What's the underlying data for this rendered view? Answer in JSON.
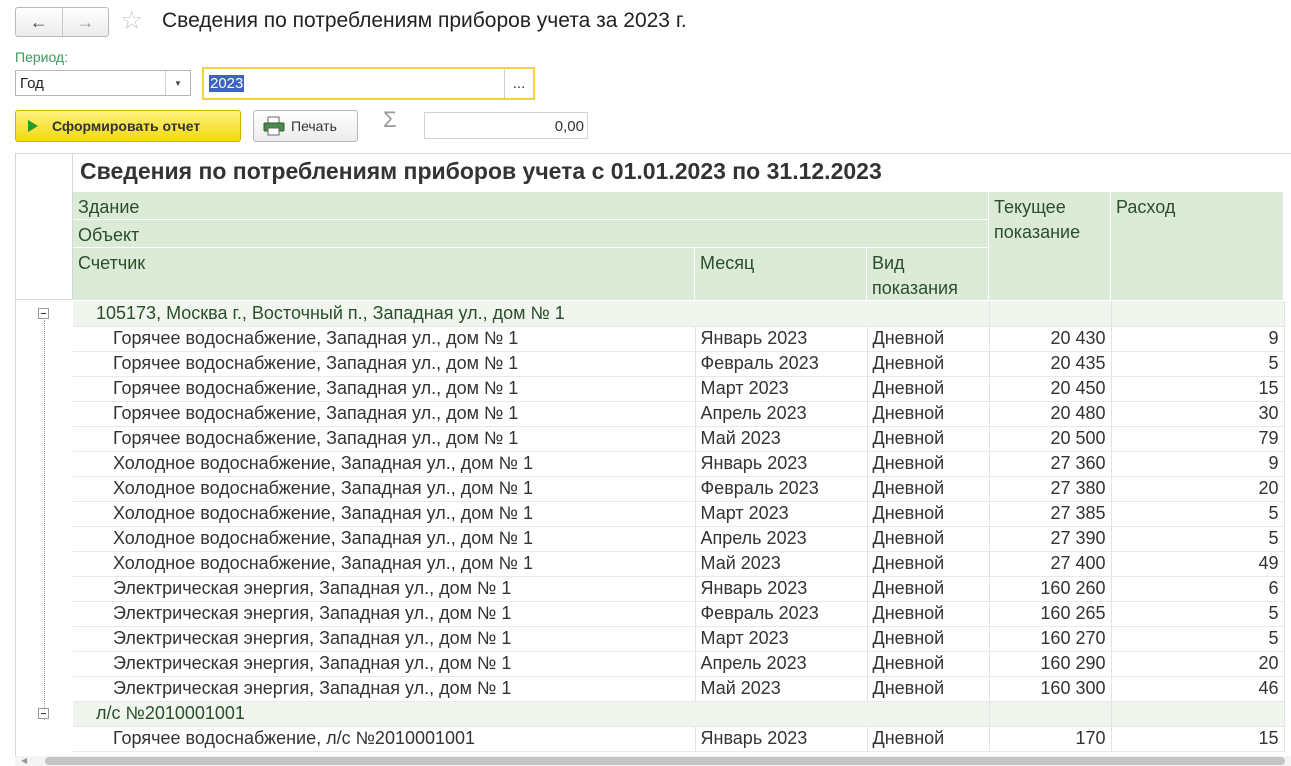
{
  "toolbar": {
    "back_icon": "←",
    "forward_icon": "→",
    "star_icon": "☆",
    "title": "Сведения по потреблениям приборов учета за 2023 г."
  },
  "filter": {
    "period_label": "Период:",
    "period_type": "Год",
    "dropdown_icon": "▼",
    "year": "2023",
    "dots": "..."
  },
  "actions": {
    "run_label": "Сформировать отчет",
    "print_label": "Печать",
    "sigma": "Σ",
    "sum_value": "0,00"
  },
  "report": {
    "title": "Сведения по потреблениям приборов учета с 01.01.2023 по 31.12.2023",
    "headers": {
      "building": "Здание",
      "object": "Объект",
      "meter": "Счетчик",
      "month": "Месяц",
      "reading_type": "Вид показания",
      "current": "Текущее показание",
      "consumption": "Расход"
    },
    "groups": [
      {
        "name": "105173, Москва г., Восточный п., Западная ул., дом № 1",
        "rows": [
          {
            "meter": "Горячее водоснабжение, Западная ул., дом № 1",
            "month": "Январь 2023",
            "type": "Дневной",
            "current": "20 430",
            "consumption": "9"
          },
          {
            "meter": "Горячее водоснабжение, Западная ул., дом № 1",
            "month": "Февраль 2023",
            "type": "Дневной",
            "current": "20 435",
            "consumption": "5"
          },
          {
            "meter": "Горячее водоснабжение, Западная ул., дом № 1",
            "month": "Март 2023",
            "type": "Дневной",
            "current": "20 450",
            "consumption": "15"
          },
          {
            "meter": "Горячее водоснабжение, Западная ул., дом № 1",
            "month": "Апрель 2023",
            "type": "Дневной",
            "current": "20 480",
            "consumption": "30"
          },
          {
            "meter": "Горячее водоснабжение, Западная ул., дом № 1",
            "month": "Май 2023",
            "type": "Дневной",
            "current": "20 500",
            "consumption": "79"
          },
          {
            "meter": "Холодное водоснабжение, Западная ул., дом № 1",
            "month": "Январь 2023",
            "type": "Дневной",
            "current": "27 360",
            "consumption": "9"
          },
          {
            "meter": "Холодное водоснабжение, Западная ул., дом № 1",
            "month": "Февраль 2023",
            "type": "Дневной",
            "current": "27 380",
            "consumption": "20"
          },
          {
            "meter": "Холодное водоснабжение, Западная ул., дом № 1",
            "month": "Март 2023",
            "type": "Дневной",
            "current": "27 385",
            "consumption": "5"
          },
          {
            "meter": "Холодное водоснабжение, Западная ул., дом № 1",
            "month": "Апрель 2023",
            "type": "Дневной",
            "current": "27 390",
            "consumption": "5"
          },
          {
            "meter": "Холодное водоснабжение, Западная ул., дом № 1",
            "month": "Май 2023",
            "type": "Дневной",
            "current": "27 400",
            "consumption": "49"
          },
          {
            "meter": "Электрическая энергия, Западная ул., дом № 1",
            "month": "Январь 2023",
            "type": "Дневной",
            "current": "160 260",
            "consumption": "6"
          },
          {
            "meter": "Электрическая энергия, Западная ул., дом № 1",
            "month": "Февраль 2023",
            "type": "Дневной",
            "current": "160 265",
            "consumption": "5"
          },
          {
            "meter": "Электрическая энергия, Западная ул., дом № 1",
            "month": "Март 2023",
            "type": "Дневной",
            "current": "160 270",
            "consumption": "5"
          },
          {
            "meter": "Электрическая энергия, Западная ул., дом № 1",
            "month": "Апрель 2023",
            "type": "Дневной",
            "current": "160 290",
            "consumption": "20"
          },
          {
            "meter": "Электрическая энергия, Западная ул., дом № 1",
            "month": "Май 2023",
            "type": "Дневной",
            "current": "160 300",
            "consumption": "46"
          }
        ]
      },
      {
        "name": "л/с №2010001001",
        "rows": [
          {
            "meter": "Горячее водоснабжение, л/с №2010001001",
            "month": "Январь 2023",
            "type": "Дневной",
            "current": "170",
            "consumption": "15"
          }
        ]
      }
    ]
  }
}
